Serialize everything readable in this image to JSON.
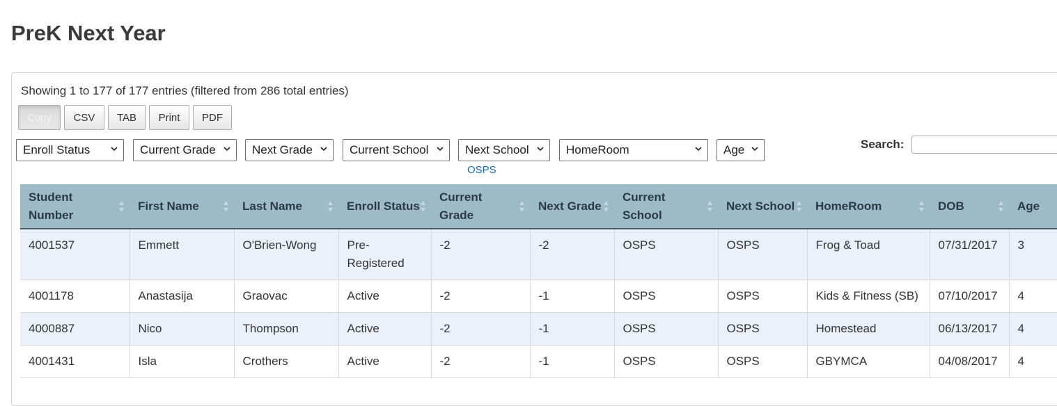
{
  "page": {
    "title": "PreK Next Year"
  },
  "table_info": "Showing 1 to 177 of 177 entries (filtered from 286 total entries)",
  "export_buttons": [
    "Copy",
    "CSV",
    "TAB",
    "Print",
    "PDF"
  ],
  "filters": {
    "enroll_status": "Enroll Status",
    "current_grade": "Current Grade",
    "next_grade": "Next Grade",
    "current_school": "Current School",
    "next_school": "Next School",
    "homeroom": "HomeRoom",
    "age": "Age",
    "next_school_selected": "OSPS"
  },
  "search": {
    "label": "Search:",
    "value": ""
  },
  "columns": [
    "Student Number",
    "First Name",
    "Last Name",
    "Enroll Status",
    "Current Grade",
    "Next Grade",
    "Current School",
    "Next School",
    "HomeRoom",
    "DOB",
    "Age"
  ],
  "rows": [
    [
      "4001537",
      "Emmett",
      "O'Brien-Wong",
      "Pre-Registered",
      "-2",
      "-2",
      "OSPS",
      "OSPS",
      "Frog & Toad",
      "07/31/2017",
      "3"
    ],
    [
      "4001178",
      "Anastasija",
      "Graovac",
      "Active",
      "-2",
      "-1",
      "OSPS",
      "OSPS",
      "Kids & Fitness (SB)",
      "07/10/2017",
      "4"
    ],
    [
      "4000887",
      "Nico",
      "Thompson",
      "Active",
      "-2",
      "-1",
      "OSPS",
      "OSPS",
      "Homestead",
      "06/13/2017",
      "4"
    ],
    [
      "4001431",
      "Isla",
      "Crothers",
      "Active",
      "-2",
      "-1",
      "OSPS",
      "OSPS",
      "GBYMCA",
      "04/08/2017",
      "4"
    ]
  ],
  "colors": {
    "header_bg": "#9dbac7",
    "odd_row_bg": "#ebf1fb",
    "link": "#1f6aa5"
  }
}
